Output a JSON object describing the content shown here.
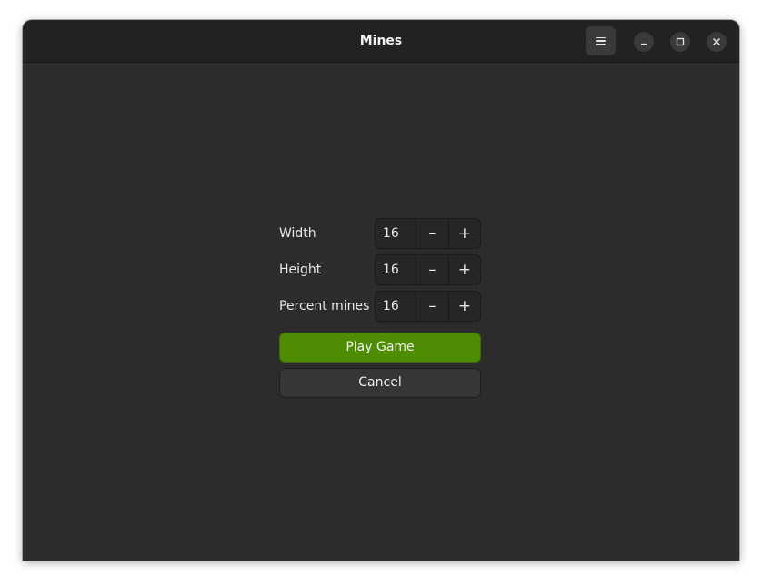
{
  "window": {
    "title": "Mines"
  },
  "headerbar": {
    "menu_icon": "hamburger-menu-icon",
    "minimize_icon": "minimize-icon",
    "maximize_icon": "maximize-icon",
    "close_icon": "close-icon"
  },
  "form": {
    "fields": [
      {
        "label": "Width",
        "value": "16",
        "minus_glyph": "–",
        "plus_glyph": "+"
      },
      {
        "label": "Height",
        "value": "16",
        "minus_glyph": "–",
        "plus_glyph": "+"
      },
      {
        "label": "Percent mines",
        "value": "16",
        "minus_glyph": "–",
        "plus_glyph": "+"
      }
    ],
    "play_label": "Play Game",
    "cancel_label": "Cancel"
  },
  "colors": {
    "window_bg": "#2c2c2c",
    "headerbar_bg": "#222222",
    "accent_green": "#4e8c03"
  }
}
